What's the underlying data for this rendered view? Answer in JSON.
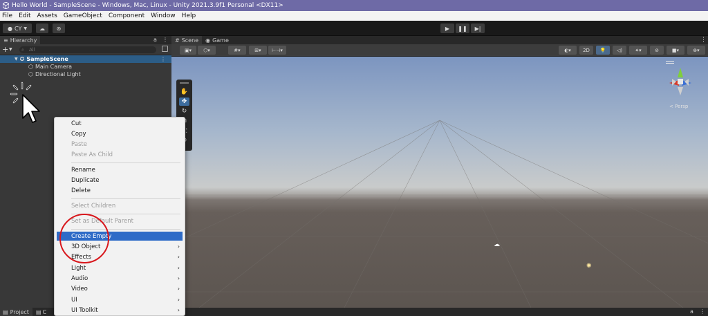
{
  "window": {
    "title": "Hello World - SampleScene - Windows, Mac, Linux - Unity 2021.3.9f1 Personal <DX11>"
  },
  "menubar": {
    "items": [
      "File",
      "Edit",
      "Assets",
      "GameObject",
      "Component",
      "Window",
      "Help"
    ]
  },
  "toolbar": {
    "account_label": "CY"
  },
  "hierarchy": {
    "tab_label": "Hierarchy",
    "search_placeholder": "All",
    "scene_name": "SampleScene",
    "objects": [
      "Main Camera",
      "Directional Light"
    ]
  },
  "scene_view": {
    "tabs": [
      "Scene",
      "Game"
    ],
    "mode_2d_label": "2D",
    "gizmo_view_label": "< Persp"
  },
  "bottom": {
    "tabs": [
      "Project",
      "C"
    ]
  },
  "context_menu": {
    "groups": [
      {
        "items": [
          {
            "label": "Cut",
            "enabled": true
          },
          {
            "label": "Copy",
            "enabled": true
          },
          {
            "label": "Paste",
            "enabled": false
          },
          {
            "label": "Paste As Child",
            "enabled": false
          }
        ]
      },
      {
        "items": [
          {
            "label": "Rename",
            "enabled": true
          },
          {
            "label": "Duplicate",
            "enabled": true
          },
          {
            "label": "Delete",
            "enabled": true
          }
        ]
      },
      {
        "items": [
          {
            "label": "Select Children",
            "enabled": false
          }
        ]
      },
      {
        "items": [
          {
            "label": "Set as Default Parent",
            "enabled": false
          }
        ]
      },
      {
        "items": [
          {
            "label": "Create Empty",
            "enabled": true,
            "highlighted": true
          },
          {
            "label": "3D Object",
            "enabled": true,
            "submenu": true
          },
          {
            "label": "Effects",
            "enabled": true,
            "submenu": true
          },
          {
            "label": "Light",
            "enabled": true,
            "submenu": true
          },
          {
            "label": "Audio",
            "enabled": true,
            "submenu": true
          },
          {
            "label": "Video",
            "enabled": true,
            "submenu": true
          },
          {
            "label": "UI",
            "enabled": true,
            "submenu": true
          },
          {
            "label": "UI Toolkit",
            "enabled": true,
            "submenu": true
          }
        ]
      }
    ],
    "submenu_arrow": "›"
  },
  "colors": {
    "titlebar": "#6e6aa6",
    "highlight": "#2e6bc7",
    "annotation_circle": "#d8171c",
    "scene_selected_row": "#2c5d87"
  }
}
